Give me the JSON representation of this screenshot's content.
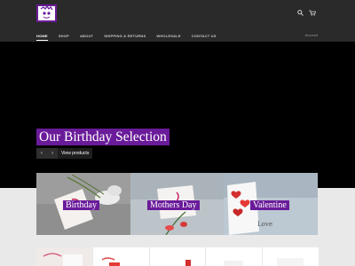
{
  "header": {
    "logo_alt": "Store logo",
    "nav": [
      {
        "label": "HOME",
        "active": true
      },
      {
        "label": "SHOP",
        "active": false
      },
      {
        "label": "ABOUT",
        "active": false
      },
      {
        "label": "SHIPPING & RETURNS",
        "active": false
      },
      {
        "label": "WHOLESALE",
        "active": false
      },
      {
        "label": "CONTACT US",
        "active": false
      }
    ],
    "account_label": "Account"
  },
  "hero": {
    "title": "Our Birthday Selection",
    "prev_symbol": "‹",
    "next_symbol": "›",
    "cta_label": "View products"
  },
  "collections": [
    {
      "label": "Birthday"
    },
    {
      "label": "Mothers Day"
    },
    {
      "label": "Valentine"
    }
  ],
  "colors": {
    "brand_purple": "#6a1b9a",
    "header_bg": "#2a2a2a",
    "hero_bg": "#000000"
  }
}
